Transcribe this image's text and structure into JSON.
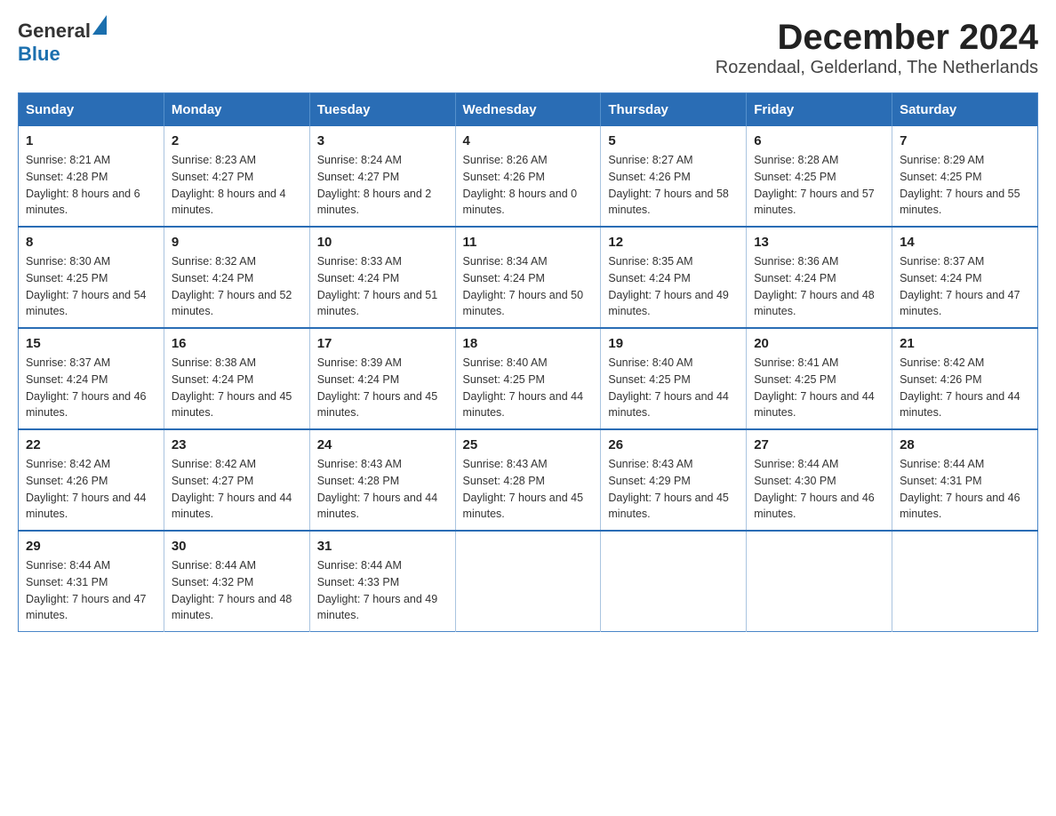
{
  "header": {
    "logo_text_general": "General",
    "logo_text_blue": "Blue",
    "title": "December 2024",
    "subtitle": "Rozendaal, Gelderland, The Netherlands"
  },
  "calendar": {
    "days_of_week": [
      "Sunday",
      "Monday",
      "Tuesday",
      "Wednesday",
      "Thursday",
      "Friday",
      "Saturday"
    ],
    "weeks": [
      [
        {
          "day": "1",
          "sunrise": "Sunrise: 8:21 AM",
          "sunset": "Sunset: 4:28 PM",
          "daylight": "Daylight: 8 hours and 6 minutes."
        },
        {
          "day": "2",
          "sunrise": "Sunrise: 8:23 AM",
          "sunset": "Sunset: 4:27 PM",
          "daylight": "Daylight: 8 hours and 4 minutes."
        },
        {
          "day": "3",
          "sunrise": "Sunrise: 8:24 AM",
          "sunset": "Sunset: 4:27 PM",
          "daylight": "Daylight: 8 hours and 2 minutes."
        },
        {
          "day": "4",
          "sunrise": "Sunrise: 8:26 AM",
          "sunset": "Sunset: 4:26 PM",
          "daylight": "Daylight: 8 hours and 0 minutes."
        },
        {
          "day": "5",
          "sunrise": "Sunrise: 8:27 AM",
          "sunset": "Sunset: 4:26 PM",
          "daylight": "Daylight: 7 hours and 58 minutes."
        },
        {
          "day": "6",
          "sunrise": "Sunrise: 8:28 AM",
          "sunset": "Sunset: 4:25 PM",
          "daylight": "Daylight: 7 hours and 57 minutes."
        },
        {
          "day": "7",
          "sunrise": "Sunrise: 8:29 AM",
          "sunset": "Sunset: 4:25 PM",
          "daylight": "Daylight: 7 hours and 55 minutes."
        }
      ],
      [
        {
          "day": "8",
          "sunrise": "Sunrise: 8:30 AM",
          "sunset": "Sunset: 4:25 PM",
          "daylight": "Daylight: 7 hours and 54 minutes."
        },
        {
          "day": "9",
          "sunrise": "Sunrise: 8:32 AM",
          "sunset": "Sunset: 4:24 PM",
          "daylight": "Daylight: 7 hours and 52 minutes."
        },
        {
          "day": "10",
          "sunrise": "Sunrise: 8:33 AM",
          "sunset": "Sunset: 4:24 PM",
          "daylight": "Daylight: 7 hours and 51 minutes."
        },
        {
          "day": "11",
          "sunrise": "Sunrise: 8:34 AM",
          "sunset": "Sunset: 4:24 PM",
          "daylight": "Daylight: 7 hours and 50 minutes."
        },
        {
          "day": "12",
          "sunrise": "Sunrise: 8:35 AM",
          "sunset": "Sunset: 4:24 PM",
          "daylight": "Daylight: 7 hours and 49 minutes."
        },
        {
          "day": "13",
          "sunrise": "Sunrise: 8:36 AM",
          "sunset": "Sunset: 4:24 PM",
          "daylight": "Daylight: 7 hours and 48 minutes."
        },
        {
          "day": "14",
          "sunrise": "Sunrise: 8:37 AM",
          "sunset": "Sunset: 4:24 PM",
          "daylight": "Daylight: 7 hours and 47 minutes."
        }
      ],
      [
        {
          "day": "15",
          "sunrise": "Sunrise: 8:37 AM",
          "sunset": "Sunset: 4:24 PM",
          "daylight": "Daylight: 7 hours and 46 minutes."
        },
        {
          "day": "16",
          "sunrise": "Sunrise: 8:38 AM",
          "sunset": "Sunset: 4:24 PM",
          "daylight": "Daylight: 7 hours and 45 minutes."
        },
        {
          "day": "17",
          "sunrise": "Sunrise: 8:39 AM",
          "sunset": "Sunset: 4:24 PM",
          "daylight": "Daylight: 7 hours and 45 minutes."
        },
        {
          "day": "18",
          "sunrise": "Sunrise: 8:40 AM",
          "sunset": "Sunset: 4:25 PM",
          "daylight": "Daylight: 7 hours and 44 minutes."
        },
        {
          "day": "19",
          "sunrise": "Sunrise: 8:40 AM",
          "sunset": "Sunset: 4:25 PM",
          "daylight": "Daylight: 7 hours and 44 minutes."
        },
        {
          "day": "20",
          "sunrise": "Sunrise: 8:41 AM",
          "sunset": "Sunset: 4:25 PM",
          "daylight": "Daylight: 7 hours and 44 minutes."
        },
        {
          "day": "21",
          "sunrise": "Sunrise: 8:42 AM",
          "sunset": "Sunset: 4:26 PM",
          "daylight": "Daylight: 7 hours and 44 minutes."
        }
      ],
      [
        {
          "day": "22",
          "sunrise": "Sunrise: 8:42 AM",
          "sunset": "Sunset: 4:26 PM",
          "daylight": "Daylight: 7 hours and 44 minutes."
        },
        {
          "day": "23",
          "sunrise": "Sunrise: 8:42 AM",
          "sunset": "Sunset: 4:27 PM",
          "daylight": "Daylight: 7 hours and 44 minutes."
        },
        {
          "day": "24",
          "sunrise": "Sunrise: 8:43 AM",
          "sunset": "Sunset: 4:28 PM",
          "daylight": "Daylight: 7 hours and 44 minutes."
        },
        {
          "day": "25",
          "sunrise": "Sunrise: 8:43 AM",
          "sunset": "Sunset: 4:28 PM",
          "daylight": "Daylight: 7 hours and 45 minutes."
        },
        {
          "day": "26",
          "sunrise": "Sunrise: 8:43 AM",
          "sunset": "Sunset: 4:29 PM",
          "daylight": "Daylight: 7 hours and 45 minutes."
        },
        {
          "day": "27",
          "sunrise": "Sunrise: 8:44 AM",
          "sunset": "Sunset: 4:30 PM",
          "daylight": "Daylight: 7 hours and 46 minutes."
        },
        {
          "day": "28",
          "sunrise": "Sunrise: 8:44 AM",
          "sunset": "Sunset: 4:31 PM",
          "daylight": "Daylight: 7 hours and 46 minutes."
        }
      ],
      [
        {
          "day": "29",
          "sunrise": "Sunrise: 8:44 AM",
          "sunset": "Sunset: 4:31 PM",
          "daylight": "Daylight: 7 hours and 47 minutes."
        },
        {
          "day": "30",
          "sunrise": "Sunrise: 8:44 AM",
          "sunset": "Sunset: 4:32 PM",
          "daylight": "Daylight: 7 hours and 48 minutes."
        },
        {
          "day": "31",
          "sunrise": "Sunrise: 8:44 AM",
          "sunset": "Sunset: 4:33 PM",
          "daylight": "Daylight: 7 hours and 49 minutes."
        },
        null,
        null,
        null,
        null
      ]
    ]
  }
}
